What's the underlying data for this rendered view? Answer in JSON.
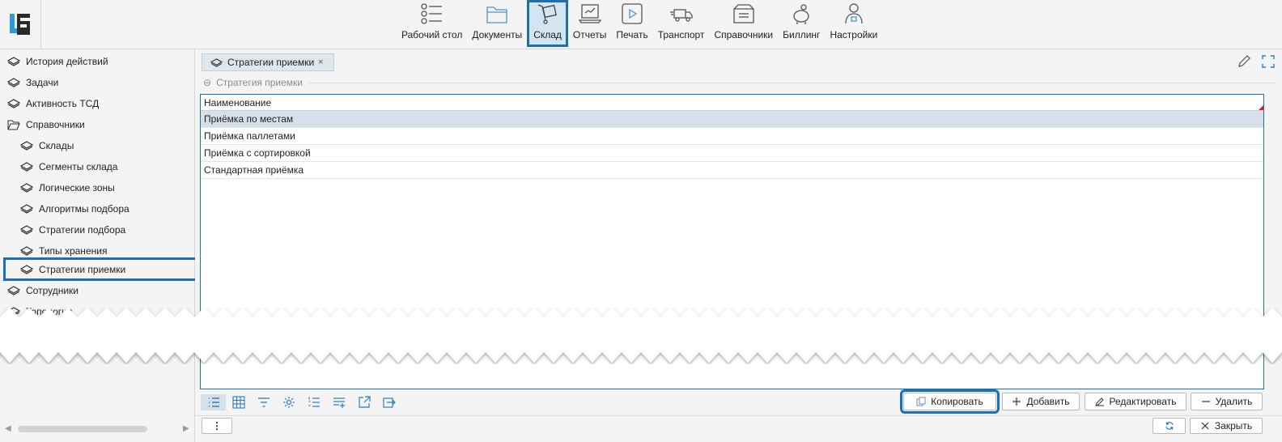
{
  "nav": [
    {
      "label": "Рабочий стол",
      "icon": "list-icon"
    },
    {
      "label": "Документы",
      "icon": "folder-icon"
    },
    {
      "label": "Склад",
      "icon": "cart-icon"
    },
    {
      "label": "Отчеты",
      "icon": "report-icon"
    },
    {
      "label": "Печать",
      "icon": "play-icon"
    },
    {
      "label": "Транспорт",
      "icon": "truck-icon"
    },
    {
      "label": "Справочники",
      "icon": "box-icon"
    },
    {
      "label": "Биллинг",
      "icon": "piggy-icon"
    },
    {
      "label": "Настройки",
      "icon": "user-lock-icon"
    }
  ],
  "sidebar": {
    "items": [
      {
        "label": "История действий",
        "icon": "layers-icon"
      },
      {
        "label": "Задачи",
        "icon": "layers-icon"
      },
      {
        "label": "Активность ТСД",
        "icon": "layers-icon"
      },
      {
        "label": "Справочники",
        "icon": "open-folder-icon"
      },
      {
        "label": "Склады",
        "icon": "layers-icon"
      },
      {
        "label": "Сегменты склада",
        "icon": "layers-icon"
      },
      {
        "label": "Логические зоны",
        "icon": "layers-icon"
      },
      {
        "label": "Алгоритмы подбора",
        "icon": "layers-icon"
      },
      {
        "label": "Стратегии подбора",
        "icon": "layers-icon"
      },
      {
        "label": "Типы хранения",
        "icon": "layers-icon"
      },
      {
        "label": "Стратегии приемки",
        "icon": "layers-icon"
      },
      {
        "label": "Сотрудники",
        "icon": "layers-icon"
      },
      {
        "label": "Топология",
        "icon": "layers-icon"
      }
    ]
  },
  "tab": {
    "label": "Стратегии приемки",
    "close": "×"
  },
  "group": {
    "title": "Стратегия приемки",
    "collapse": "⊖"
  },
  "grid": {
    "column": "Наименование",
    "rows": [
      "Приёмка по местам",
      "Приёмка паллетами",
      "Приёмка с сортировкой",
      "Стандартная приёмка"
    ]
  },
  "buttons": {
    "copy": "Копировать",
    "add": "Добавить",
    "edit": "Редактировать",
    "delete": "Удалить",
    "close": "Закрыть",
    "more": "⋮"
  },
  "colors": {
    "accent": "#1c6fb0",
    "selected_row": "#d5e0ea"
  }
}
